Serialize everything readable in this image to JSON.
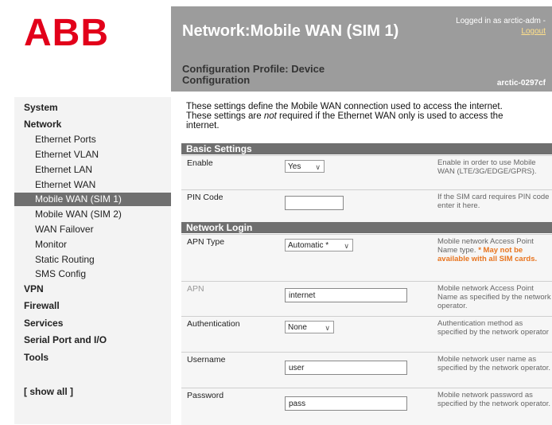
{
  "brand": {
    "logo_text": "ABB",
    "logo_color": "#e2001a"
  },
  "header": {
    "title": "Network:Mobile WAN (SIM 1)",
    "logged_in": "Logged in as arctic-adm -",
    "logout": "Logout",
    "profile_line1": "Configuration Profile: Device",
    "profile_line2": "Configuration",
    "hostname": "arctic-0297cf"
  },
  "sidebar": {
    "system": "System",
    "network": "Network",
    "items": [
      "Ethernet Ports",
      "Ethernet VLAN",
      "Ethernet LAN",
      "Ethernet WAN",
      "Mobile WAN (SIM 1)",
      "Mobile WAN (SIM 2)",
      "WAN Failover",
      "Monitor",
      "Static Routing",
      "SMS Config"
    ],
    "vpn": "VPN",
    "firewall": "Firewall",
    "services": "Services",
    "serial": "Serial Port and I/O",
    "tools": "Tools",
    "show_all": "[ show all ]"
  },
  "main": {
    "intro_1": "These settings define the Mobile WAN connection used to access the internet.",
    "intro_2a": "These settings are ",
    "intro_2b": "not",
    "intro_2c": " required if the Ethernet WAN only is used to access the",
    "intro_3": "internet.",
    "basic_section": "Basic Settings",
    "enable_label": "Enable",
    "enable_value": "Yes",
    "enable_help": "Enable in order to use Mobile WAN (LTE/3G/EDGE/GPRS).",
    "pin_label": "PIN Code",
    "pin_value": "",
    "pin_help": "If the SIM card requires PIN code enter it here.",
    "login_section": "Network Login",
    "apn_type_label": "APN Type",
    "apn_type_value": "Automatic *",
    "apn_type_help": "Mobile network Access Point Name type.",
    "apn_type_warn": "* May not be available with all SIM cards.",
    "apn_label": "APN",
    "apn_value": "internet",
    "apn_help": "Mobile network Access Point Name as specified by the network operator.",
    "auth_label": "Authentication",
    "auth_value": "None",
    "auth_help": "Authentication method as specified by the network operator",
    "user_label": "Username",
    "user_value": "user",
    "user_help": "Mobile network user name as specified by the network operator.",
    "pass_label": "Password",
    "pass_value": "pass",
    "pass_help": "Mobile network password as specified by the network operator."
  }
}
